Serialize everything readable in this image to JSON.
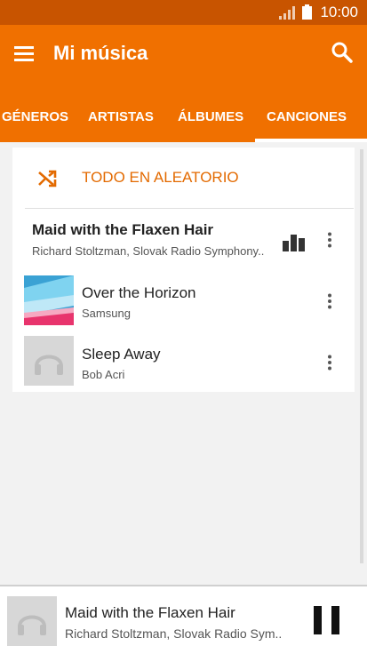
{
  "status": {
    "time": "10:00"
  },
  "appbar": {
    "title": "Mi música"
  },
  "tabs": [
    {
      "label": "GÉNEROS"
    },
    {
      "label": "ARTISTAS"
    },
    {
      "label": "ÁLBUMES"
    },
    {
      "label": "CANCIONES",
      "active": true
    }
  ],
  "shuffle": {
    "label": "TODO EN ALEATORIO"
  },
  "songs": [
    {
      "title": "Maid with the Flaxen Hair",
      "artist": "Richard Stoltzman, Slovak Radio Symphony..",
      "playing": true
    },
    {
      "title": "Over the Horizon",
      "artist": "Samsung"
    },
    {
      "title": "Sleep Away",
      "artist": "Bob Acri"
    }
  ],
  "player": {
    "title": "Maid with the Flaxen Hair",
    "artist": "Richard Stoltzman, Slovak Radio Sym.."
  },
  "colors": {
    "accent": "#f07000",
    "statusbar": "#c85400",
    "shuffle_text": "#e36a00"
  }
}
